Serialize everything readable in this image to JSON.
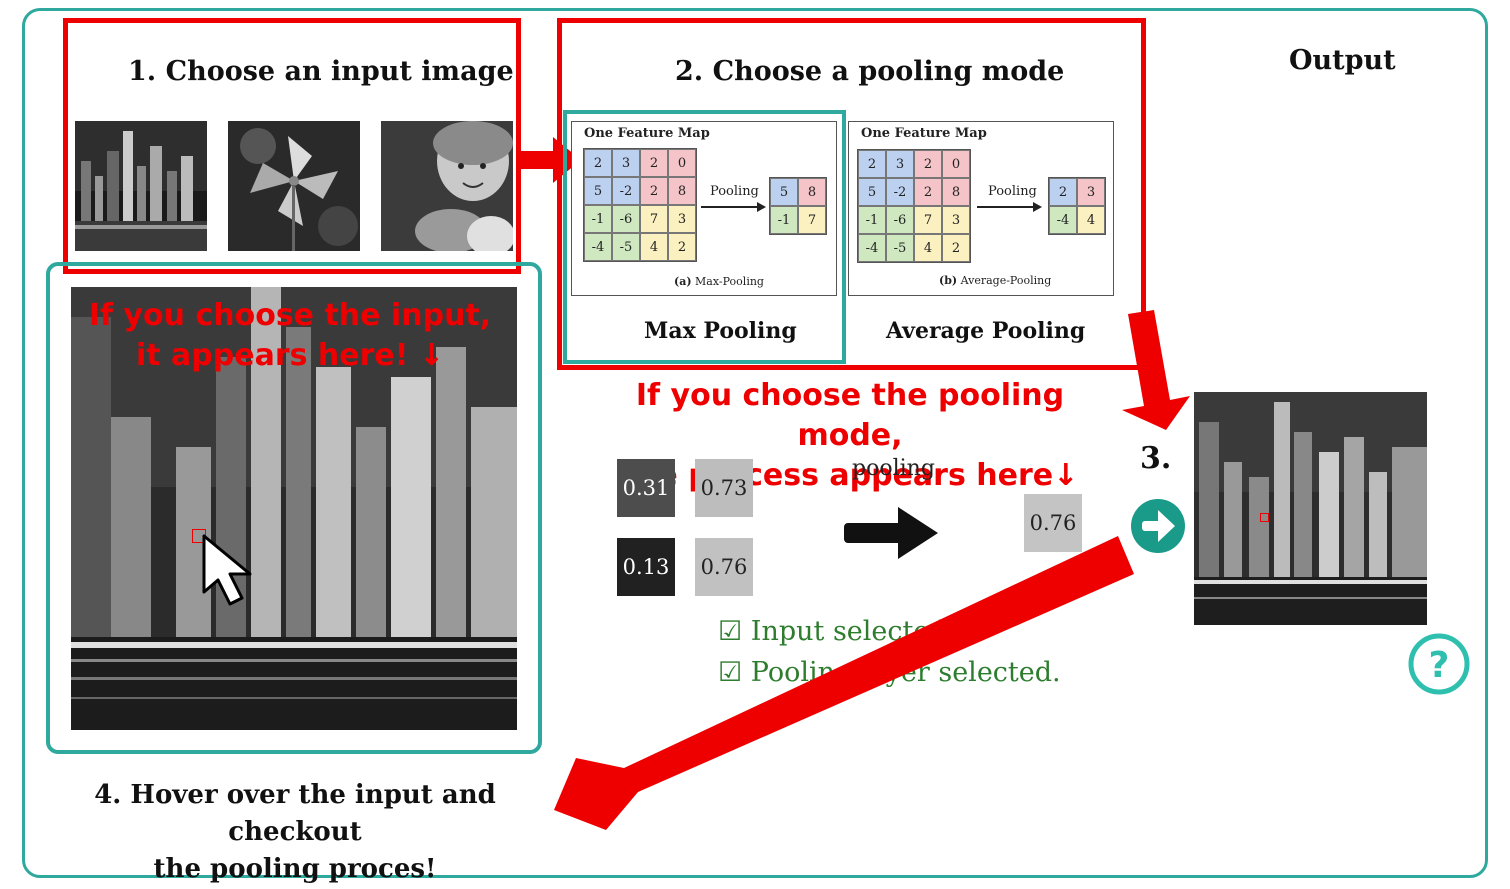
{
  "step1": {
    "title": "1. Choose an input image",
    "thumbnails": [
      "city-night-thumbnail",
      "pinwheel-thumbnail",
      "child-thumbnail"
    ]
  },
  "step2": {
    "title": "2. Choose a pooling mode",
    "max_panel": {
      "header": "One Feature Map",
      "grid": [
        [
          "2",
          "3",
          "2",
          "0"
        ],
        [
          "5",
          "-2",
          "2",
          "8"
        ],
        [
          "-1",
          "-6",
          "7",
          "3"
        ],
        [
          "-4",
          "-5",
          "4",
          "2"
        ]
      ],
      "arrow_label": "Pooling",
      "result": [
        [
          "5",
          "8"
        ],
        [
          "-1",
          "7"
        ]
      ],
      "caption_letter": "(a)",
      "caption_text": "Max-Pooling",
      "label": "Max Pooling"
    },
    "avg_panel": {
      "header": "One Feature Map",
      "grid": [
        [
          "2",
          "3",
          "2",
          "0"
        ],
        [
          "5",
          "-2",
          "2",
          "8"
        ],
        [
          "-1",
          "-6",
          "7",
          "3"
        ],
        [
          "-4",
          "-5",
          "4",
          "2"
        ]
      ],
      "arrow_label": "Pooling",
      "result": [
        [
          "2",
          "3"
        ],
        [
          "-4",
          "4"
        ]
      ],
      "caption_letter": "(b)",
      "caption_text": "Average-Pooling",
      "label": "Average Pooling"
    }
  },
  "output": {
    "title": "Output"
  },
  "notes": {
    "input_line1": "If you choose the input,",
    "input_line2": "it appears here! ↓",
    "pool_line1": "If you choose the pooling mode,",
    "pool_line2": "the process appears here↓"
  },
  "process": {
    "values": [
      "0.31",
      "0.73",
      "0.13",
      "0.76"
    ],
    "value_colors": [
      "#4d4d4d",
      "#bdbdbd",
      "#212121",
      "#c1c1c1"
    ],
    "label": "pooling",
    "result": "0.76"
  },
  "step3": {
    "label": "3."
  },
  "status": {
    "line1": "☑ Input selected.",
    "line2": "☑ Pooling layer selected."
  },
  "step4": {
    "line1": "4. Hover over the input and checkout",
    "line2": "the pooling proces!"
  },
  "colors": {
    "frame": "#2fa89d",
    "annotation": "#ee0000",
    "status": "#2e7d2e",
    "go_button": "#1a9b8a"
  },
  "icons": {
    "go": "arrow-right-circle-icon",
    "help": "question-circle-icon",
    "cursor": "mouse-pointer-icon"
  }
}
